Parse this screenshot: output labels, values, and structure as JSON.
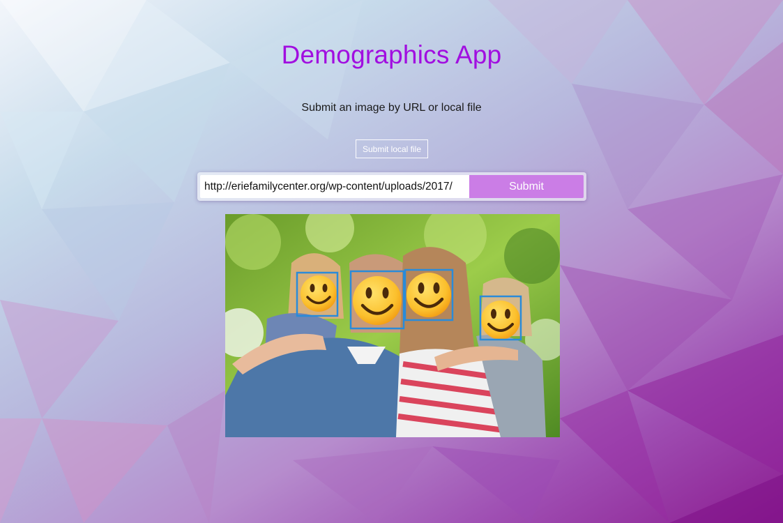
{
  "app": {
    "title": "Demographics App",
    "subtitle": "Submit an image by URL or local file"
  },
  "controls": {
    "local_file_label": "Submit local file",
    "url_value": "http://eriefamilycenter.org/wp-content/uploads/2017/",
    "submit_label": "Submit"
  },
  "result_image": {
    "faces_detected": 4,
    "face_marker_icon": "smiley-face-icon",
    "box_color": "#2a8bd9"
  },
  "colors": {
    "title": "#a10ee0",
    "submit_button": "#cb7de6"
  }
}
